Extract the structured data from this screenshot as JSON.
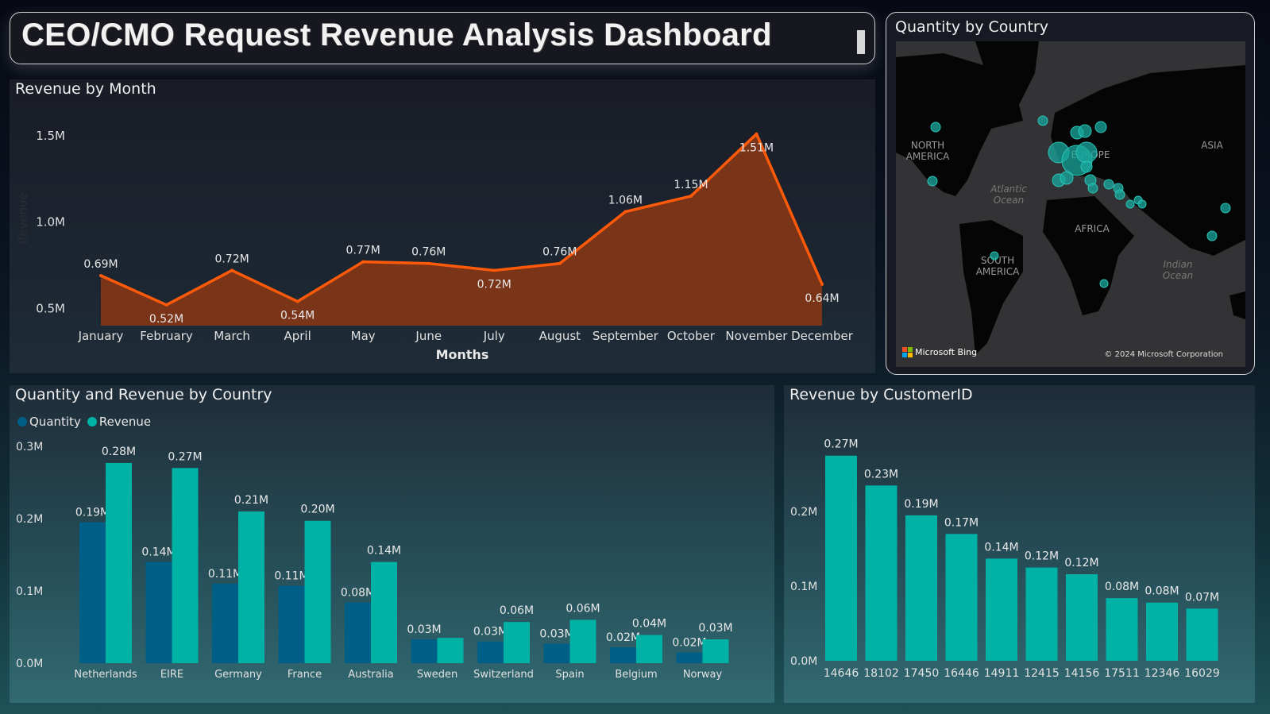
{
  "header": {
    "title": "CEO/CMO Request Revenue Analysis Dashboard"
  },
  "colors": {
    "line": "#ff5a0a",
    "area": "#7a3518",
    "quantity": "#005f86",
    "revenue": "#00b2a6",
    "map_bubble": "#1aa89e"
  },
  "map": {
    "title": "Quantity by Country",
    "labels": [
      "NORTH AMERICA",
      "EUROPE",
      "ASIA",
      "AFRICA",
      "SOUTH AMERICA",
      "Atlantic Ocean",
      "Indian Ocean"
    ],
    "attribution": "Microsoft Bing",
    "copyright": "© 2024 Microsoft Corporation"
  },
  "chart_data": [
    {
      "type": "area",
      "title": "Revenue by Month",
      "xlabel": "Months",
      "ylabel": "Revenue",
      "categories": [
        "January",
        "February",
        "March",
        "April",
        "May",
        "June",
        "July",
        "August",
        "September",
        "October",
        "November",
        "December"
      ],
      "values": [
        0.69,
        0.52,
        0.72,
        0.54,
        0.77,
        0.76,
        0.72,
        0.76,
        1.06,
        1.15,
        1.51,
        0.64
      ],
      "data_labels": [
        "0.69M",
        "0.52M",
        "0.72M",
        "0.54M",
        "0.77M",
        "0.76M",
        "0.72M",
        "0.76M",
        "1.06M",
        "1.15M",
        "1.51M",
        "0.64M"
      ],
      "unit": "M",
      "yticks": [
        "0.5M",
        "1.0M",
        "1.5M"
      ],
      "ytick_values": [
        0.5,
        1.0,
        1.5
      ],
      "ylim": [
        0.4,
        1.55
      ],
      "grid": false
    },
    {
      "type": "bar",
      "title": "Quantity and Revenue by Country",
      "categories": [
        "Netherlands",
        "EIRE",
        "Germany",
        "France",
        "Australia",
        "Sweden",
        "Switzerland",
        "Spain",
        "Belgium",
        "Norway"
      ],
      "series": [
        {
          "name": "Quantity",
          "values": [
            0.195,
            0.14,
            0.11,
            0.107,
            0.084,
            0.033,
            0.03,
            0.027,
            0.022,
            0.015
          ],
          "labels": [
            "0.19M",
            "0.14M",
            "0.11M",
            "0.11M",
            "0.08M",
            "0.03M",
            "0.03M",
            "0.03M",
            "0.02M",
            "0.02M"
          ]
        },
        {
          "name": "Revenue",
          "values": [
            0.277,
            0.27,
            0.21,
            0.197,
            0.14,
            0.035,
            0.057,
            0.06,
            0.039,
            0.033
          ],
          "labels": [
            "0.28M",
            "0.27M",
            "0.21M",
            "0.20M",
            "0.14M",
            "",
            "0.06M",
            "0.06M",
            "0.04M",
            "0.03M"
          ]
        }
      ],
      "legend": "top-left",
      "yticks": [
        "0.0M",
        "0.1M",
        "0.2M",
        "0.3M"
      ],
      "ytick_values": [
        0,
        0.1,
        0.2,
        0.3
      ],
      "ylim": [
        0,
        0.3
      ],
      "grid": false
    },
    {
      "type": "bar",
      "title": "Revenue by CustomerID",
      "categories": [
        "14646",
        "18102",
        "17450",
        "16446",
        "14911",
        "12415",
        "14156",
        "17511",
        "12346",
        "16029"
      ],
      "values": [
        0.275,
        0.235,
        0.195,
        0.17,
        0.137,
        0.125,
        0.116,
        0.084,
        0.078,
        0.07
      ],
      "labels": [
        "0.27M",
        "0.23M",
        "0.19M",
        "0.17M",
        "0.14M",
        "0.12M",
        "0.12M",
        "0.08M",
        "0.08M",
        "0.07M"
      ],
      "yticks": [
        "0.0M",
        "0.1M",
        "0.2M"
      ],
      "ytick_values": [
        0,
        0.1,
        0.2
      ],
      "ylim": [
        0,
        0.28
      ],
      "grid": false
    }
  ]
}
